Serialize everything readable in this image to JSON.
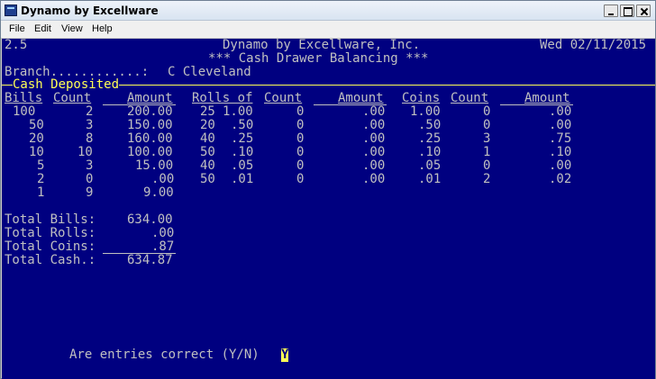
{
  "window": {
    "title": "Dynamo by Excellware",
    "app_icon": "terminal-app-icon"
  },
  "menu": [
    "File",
    "Edit",
    "View",
    "Help"
  ],
  "header": {
    "version": "2.5",
    "company": "Dynamo by Excellware, Inc.",
    "date": "Wed 02/11/2015",
    "screen_title": "*** Cash Drawer Balancing ***",
    "branch_label": "Branch............:",
    "branch_value": "C Cleveland",
    "section": "Cash Deposited"
  },
  "columns": {
    "bills": "Bills",
    "count1": "Count",
    "amount1": "Amount",
    "rolls_of": "Rolls of",
    "count2": "Count",
    "amount2": "Amount",
    "coins": "Coins",
    "count3": "Count",
    "amount3": "Amount"
  },
  "rows": [
    {
      "bill": "100",
      "bill_count": "2",
      "bill_amount": "200.00",
      "roll_qty": "25",
      "roll_denom": "1.00",
      "roll_count": "0",
      "roll_amount": ".00",
      "coin": "1.00",
      "coin_count": "0",
      "coin_amount": ".00"
    },
    {
      "bill": "50",
      "bill_count": "3",
      "bill_amount": "150.00",
      "roll_qty": "20",
      "roll_denom": ".50",
      "roll_count": "0",
      "roll_amount": ".00",
      "coin": ".50",
      "coin_count": "0",
      "coin_amount": ".00"
    },
    {
      "bill": "20",
      "bill_count": "8",
      "bill_amount": "160.00",
      "roll_qty": "40",
      "roll_denom": ".25",
      "roll_count": "0",
      "roll_amount": ".00",
      "coin": ".25",
      "coin_count": "3",
      "coin_amount": ".75"
    },
    {
      "bill": "10",
      "bill_count": "10",
      "bill_amount": "100.00",
      "roll_qty": "50",
      "roll_denom": ".10",
      "roll_count": "0",
      "roll_amount": ".00",
      "coin": ".10",
      "coin_count": "1",
      "coin_amount": ".10"
    },
    {
      "bill": "5",
      "bill_count": "3",
      "bill_amount": "15.00",
      "roll_qty": "40",
      "roll_denom": ".05",
      "roll_count": "0",
      "roll_amount": ".00",
      "coin": ".05",
      "coin_count": "0",
      "coin_amount": ".00"
    },
    {
      "bill": "2",
      "bill_count": "0",
      "bill_amount": ".00",
      "roll_qty": "50",
      "roll_denom": ".01",
      "roll_count": "0",
      "roll_amount": ".00",
      "coin": ".01",
      "coin_count": "2",
      "coin_amount": ".02"
    },
    {
      "bill": "1",
      "bill_count": "9",
      "bill_amount": "9.00"
    }
  ],
  "totals": [
    {
      "label": "Total Bills:",
      "value": "634.00"
    },
    {
      "label": "Total Rolls:",
      "value": ".00"
    },
    {
      "label": "Total Coins:",
      "value": ".87"
    },
    {
      "label": "Total Cash.:",
      "value": "634.87"
    }
  ],
  "prompt": {
    "text": "Are entries correct (Y/N)",
    "answer": "Y"
  },
  "colors": {
    "background": "#000080",
    "text": "#c0c0c0",
    "highlight": "#ffff55"
  }
}
